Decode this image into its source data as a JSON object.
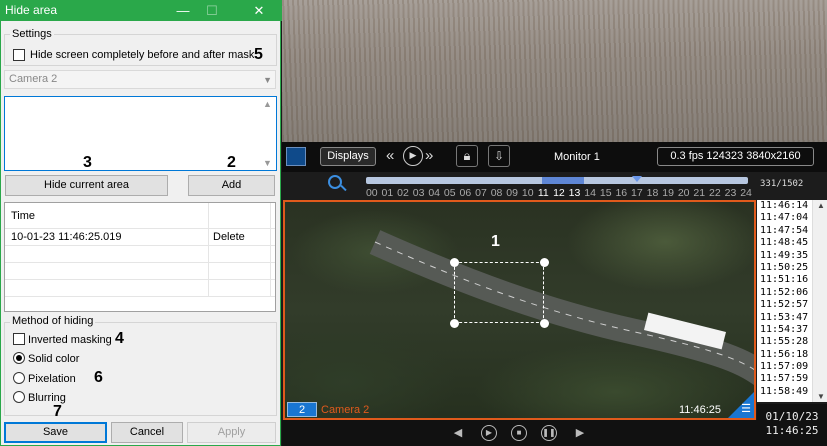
{
  "dialog": {
    "title": "Hide area",
    "settings_legend": "Settings",
    "hide_screen_label": "Hide screen completely before and after mask",
    "camera_select": "Camera 2",
    "hide_current_area_btn": "Hide current area",
    "add_btn": "Add",
    "table": {
      "col_time": "Time",
      "rows": [
        {
          "time": "10-01-23 11:46:25.019",
          "action": "Delete"
        }
      ]
    },
    "method_legend": "Method of hiding",
    "inverted_label": "Inverted masking",
    "radios": [
      {
        "label": "Solid color",
        "selected": true
      },
      {
        "label": "Pixelation",
        "selected": false
      },
      {
        "label": "Blurring",
        "selected": false
      }
    ],
    "save_btn": "Save",
    "cancel_btn": "Cancel",
    "apply_btn": "Apply",
    "callouts": {
      "n5": "5",
      "n3": "3",
      "n2": "2",
      "n4": "4",
      "n6": "6",
      "n7": "7"
    }
  },
  "viewer": {
    "displays_btn": "Displays",
    "monitor_label": "Monitor 1",
    "fps_info": "0.3 fps 124323 3840x2160",
    "hours": [
      "00",
      "01",
      "02",
      "03",
      "04",
      "05",
      "06",
      "07",
      "08",
      "09",
      "10",
      "11",
      "12",
      "13",
      "14",
      "15",
      "16",
      "17",
      "18",
      "19",
      "20",
      "21",
      "22",
      "23",
      "24"
    ],
    "counter": "331/1502",
    "camera_number": "2",
    "camera_name": "Camera 2",
    "video_time": "11:46:25",
    "video_callout": "1",
    "events": [
      "11:46:14",
      "11:47:04",
      "11:47:54",
      "11:48:45",
      "11:49:35",
      "11:50:25",
      "11:51:16",
      "11:52:06",
      "11:52:57",
      "11:53:47",
      "11:54:37",
      "11:55:28",
      "11:56:18",
      "11:57:09",
      "11:57:59",
      "11:58:49"
    ],
    "date": "01/10/23",
    "time": "11:46:25",
    "accent_color": "#e05a1c",
    "selection_color": "#2aa84a"
  }
}
